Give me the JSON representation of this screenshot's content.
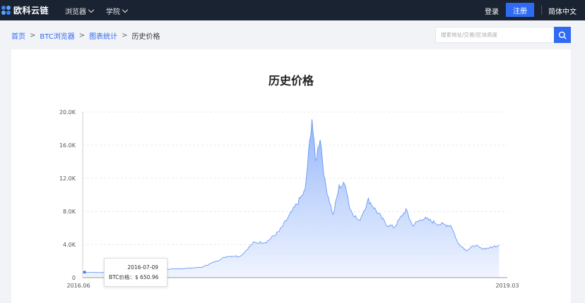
{
  "nav": {
    "logo_text": "欧科云链",
    "browser": "浏览器",
    "academy": "学院",
    "login": "登录",
    "register": "注册",
    "language": "简体中文"
  },
  "breadcrumb": {
    "home": "首页",
    "explorer": "BTC浏览器",
    "stats": "图表统计",
    "current": "历史价格",
    "separator": ">"
  },
  "search": {
    "placeholder": "搜索地址/交易/区块高度"
  },
  "tooltip": {
    "date": "2016-07-09",
    "label": "BTC价格：",
    "value": "$ 650.96"
  },
  "colors": {
    "nav_bg": "#1a2332",
    "accent": "#2f6bf2",
    "line": "#5b8ff9",
    "area_top": "#8fb3fb",
    "area_bottom": "#eef3fe"
  },
  "chart_data": {
    "type": "area",
    "title": "历史价格",
    "y_ticks": [
      "0",
      "4.0K",
      "8.0K",
      "12.0K",
      "16.0K",
      "20.0K"
    ],
    "ylim": [
      0,
      20000
    ],
    "x_tick_labels": [
      "2016.06",
      "2019.03"
    ],
    "grid": true,
    "series": [
      {
        "x": [
          "2016-07",
          "2016-08",
          "2016-09",
          "2016-10",
          "2016-11",
          "2016-12",
          "2017-01",
          "2017-02",
          "2017-03",
          "2017-04",
          "2017-05",
          "2017-06",
          "2017-07",
          "2017-08",
          "2017-09",
          "2017-10",
          "2017-11",
          "2017-12-01",
          "2017-12-17",
          "2017-12-25",
          "2018-01-06",
          "2018-01-17",
          "2018-02-06",
          "2018-02-20",
          "2018-03-05",
          "2018-03-15",
          "2018-04-06",
          "2018-04-28",
          "2018-05-10",
          "2018-06-10",
          "2018-06-28",
          "2018-07-25",
          "2018-08-10",
          "2018-09-05",
          "2018-10-10",
          "2018-11-10",
          "2018-11-25",
          "2018-12-15",
          "2019-01-05",
          "2019-01-20",
          "2019-02-10",
          "2019-03-01"
        ],
        "values": [
          650,
          620,
          610,
          640,
          730,
          900,
          1000,
          1050,
          1150,
          1250,
          1900,
          2600,
          2600,
          4200,
          4300,
          5600,
          8000,
          10500,
          19300,
          14000,
          17000,
          11500,
          7500,
          11000,
          11300,
          8300,
          6800,
          9400,
          8500,
          6400,
          6100,
          8200,
          6300,
          7200,
          6500,
          6300,
          4200,
          3300,
          3900,
          3500,
          3600,
          3950
        ]
      }
    ]
  }
}
